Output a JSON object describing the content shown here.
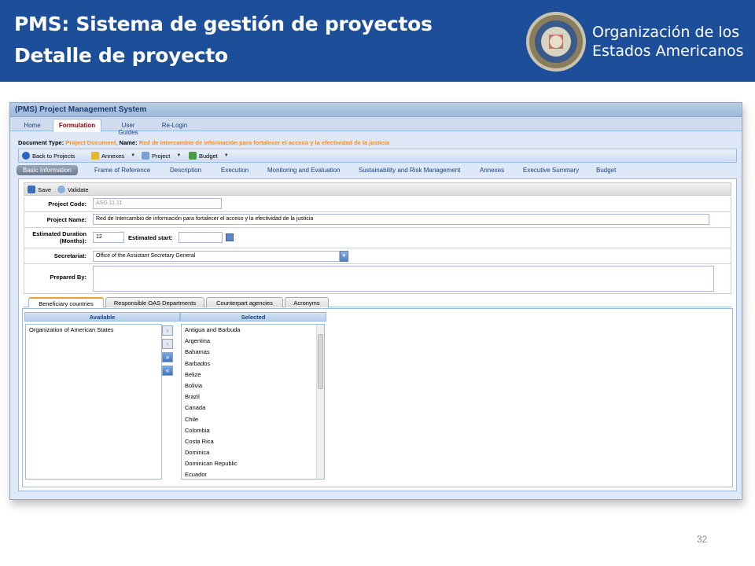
{
  "slide": {
    "title_line1": "PMS: Sistema de gestión de proyectos",
    "title_line2": "Detalle de proyecto",
    "org_line1": "Organización de los",
    "org_line2": "Estados Americanos",
    "page_number": "32"
  },
  "app": {
    "window_title": "(PMS) Project Management System",
    "main_tabs": [
      "Home",
      "Formulation",
      "User Guides",
      "Re-Login"
    ],
    "active_main_tab": "Formulation",
    "doc_type_label": "Document Type:",
    "doc_type_value": "Project Document,",
    "name_label": "Name:",
    "name_value": "Red de Intercambio de información para fortalecer el acceso y la efectividad de la justicia",
    "toolbar": {
      "back_label": "Back to Projects",
      "annexes_label": "Annexes",
      "project_label": "Project",
      "budget_label": "Budget"
    },
    "sub_tabs": [
      "Basic Information",
      "Frame of Reference",
      "Description",
      "Execution",
      "Monitoring and Evaluation",
      "Sustainability and Risk Management",
      "Annexes",
      "Executive Summary",
      "Budget"
    ],
    "form_toolbar": {
      "save_label": "Save",
      "validate_label": "Validate"
    },
    "form": {
      "project_code_label": "Project Code:",
      "project_code_value": "ASG.11.11",
      "project_name_label": "Project Name:",
      "project_name_value": "Red de Intercambio de información para fortalecer el acceso y la efectividad de la justicia",
      "duration_label_1": "Estimated Duration",
      "duration_label_2": "(Months):",
      "duration_value": "12",
      "start_label": "Estimated start:",
      "start_value": "",
      "secretariat_label": "Secretariat:",
      "secretariat_value": "Office of the Assistant Secretary General",
      "prepared_by_label": "Prepared By:",
      "prepared_by_value": ""
    },
    "lower_tabs": [
      "Beneficiary countries",
      "Responsible OAS Departments",
      "Counterpart agencies",
      "Acronyms"
    ],
    "dual_list": {
      "available_header": "Available",
      "selected_header": "Selected",
      "available": [
        "Organization of American States"
      ],
      "selected": [
        "Antigua and Barbuda",
        "Argentina",
        "Bahamas",
        "Barbados",
        "Belize",
        "Bolivia",
        "Brazil",
        "Canada",
        "Chile",
        "Colombia",
        "Costa Rica",
        "Dominica",
        "Dominican Republic",
        "Ecuador"
      ],
      "buttons": [
        "›",
        "‹",
        "»",
        "«"
      ]
    }
  },
  "colors": {
    "header_blue": "#1d4e9a",
    "orange_text": "#ff8c1a",
    "tab_blue_text": "#15428b"
  }
}
